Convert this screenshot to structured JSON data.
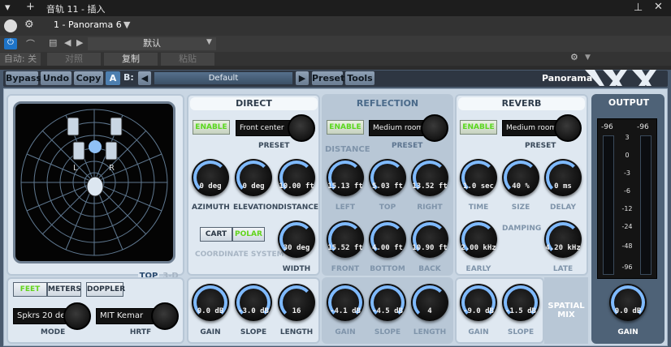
{
  "host": {
    "title": "音轨 11 - 插入",
    "device": "1 - Panorama 6",
    "preset_default": "默认",
    "auto_label": "自动: 关",
    "compare_label": "对照",
    "copy_label": "复制",
    "paste_label": "粘贴"
  },
  "toolbar": {
    "bypass": "Bypass",
    "undo": "Undo",
    "copy": "Copy",
    "ab_a": "A",
    "ab_b": "B:",
    "preset_name": "Default",
    "preset": "Preset",
    "tools": "Tools",
    "brand": "Panorama"
  },
  "radar": {
    "left_label": "L",
    "right_label": "R",
    "top_tab": "TOP",
    "threed_tab": "3-D"
  },
  "units": {
    "feet": "FEET",
    "meters": "METERS",
    "doppler": "DOPPLER"
  },
  "mode": {
    "value": "Spkrs 20 deg",
    "label": "MODE"
  },
  "hrtf": {
    "value": "MIT Kemar",
    "label": "HRTF"
  },
  "direct": {
    "title": "DIRECT",
    "enable": "ENABLE",
    "preset_value": "Front center",
    "preset_label": "PRESET",
    "azimuth": {
      "value": "0 deg",
      "label": "AZIMUTH"
    },
    "elevation": {
      "value": "0 deg",
      "label": "ELEVATION"
    },
    "distance": {
      "value": "10.00 ft",
      "label": "DISTANCE"
    },
    "cart": "CART",
    "polar": "POLAR",
    "coord_label": "COORDINATE SYSTEM",
    "width": {
      "value": "30 deg",
      "label": "WIDTH"
    },
    "gain": {
      "value": "0.0 dB",
      "label": "GAIN"
    },
    "slope": {
      "value": "-3.0 dB",
      "label": "SLOPE"
    },
    "length": {
      "value": "16",
      "label": "LENGTH"
    }
  },
  "reflection": {
    "title": "REFLECTION",
    "enable": "ENABLE",
    "preset_value": "Medium room",
    "distance_label": "DISTANCE",
    "preset_label": "PRESET",
    "left": {
      "value": "15.13 ft",
      "label": "LEFT"
    },
    "top": {
      "value": "5.03 ft",
      "label": "TOP"
    },
    "right": {
      "value": "13.52 ft",
      "label": "RIGHT"
    },
    "front": {
      "value": "15.52 ft",
      "label": "FRONT"
    },
    "bottom": {
      "value": "4.00 ft",
      "label": "BOTTOM"
    },
    "back": {
      "value": "10.90 ft",
      "label": "BACK"
    },
    "gain": {
      "value": "-4.1 dB",
      "label": "GAIN"
    },
    "slope": {
      "value": "-4.5 dB",
      "label": "SLOPE"
    },
    "length": {
      "value": "4",
      "label": "LENGTH"
    }
  },
  "reverb": {
    "title": "REVERB",
    "enable": "ENABLE",
    "preset_value": "Medium room",
    "preset_label": "PRESET",
    "time": {
      "value": "1.0 sec",
      "label": "TIME"
    },
    "size": {
      "value": "40 %",
      "label": "SIZE"
    },
    "delay": {
      "value": "0 ms",
      "label": "DELAY"
    },
    "damping_label": "DAMPING",
    "early": {
      "value": "2.00 kHz",
      "label": "EARLY"
    },
    "late": {
      "value": "4.20 kHz",
      "label": "LATE"
    },
    "gain": {
      "value": "-9.0 dB",
      "label": "GAIN"
    },
    "slope": {
      "value": "-1.5 dB",
      "label": "SLOPE"
    },
    "spatial_mix": "SPATIAL MIX"
  },
  "output": {
    "title": "OUTPUT",
    "peak_l": "-96",
    "peak_r": "-96",
    "scale": [
      "3",
      "0",
      "-3",
      "-6",
      "-12",
      "-24",
      "-48",
      "-96"
    ],
    "gain": {
      "value": "0.0 dB",
      "label": "GAIN"
    }
  },
  "colors": {
    "accent": "#7fbaff",
    "enable_green": "#5ad81e",
    "panel_bg": "#dfe8f1",
    "toolbar_bg": "#2e3642"
  }
}
